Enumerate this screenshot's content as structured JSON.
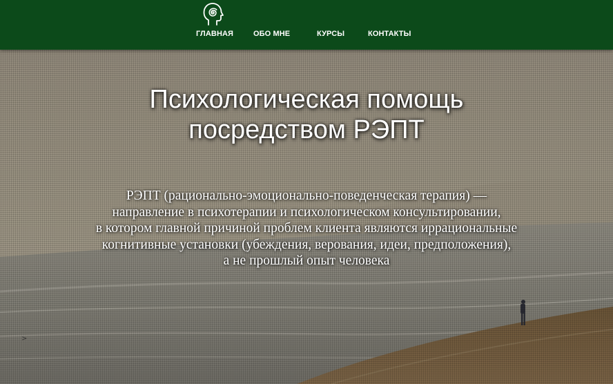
{
  "header": {
    "logo_icon": "head-spiral-icon",
    "background_color": "#0c4a1a",
    "nav": [
      {
        "label": "ГЛАВНАЯ"
      },
      {
        "label": "ОБО МНЕ"
      },
      {
        "label": "КУРСЫ"
      },
      {
        "label": "КОНТАКТЫ"
      }
    ]
  },
  "hero": {
    "title_lines": [
      "Психологическая помощь",
      "посредством РЭПТ"
    ],
    "description_lines": [
      "РЭПТ (рационально-эмоционально-поведенческая терапия) —",
      "направление в психотерапии и психологическом консультировании,",
      "в котором главной причиной проблем клиента являются иррациональные",
      "когнитивные установки (убеждения, верования, идеи, предположения),",
      "а не прошлый опыт человека"
    ],
    "arrow_glyph": ">",
    "background_description_icon": "seaside-photo"
  }
}
